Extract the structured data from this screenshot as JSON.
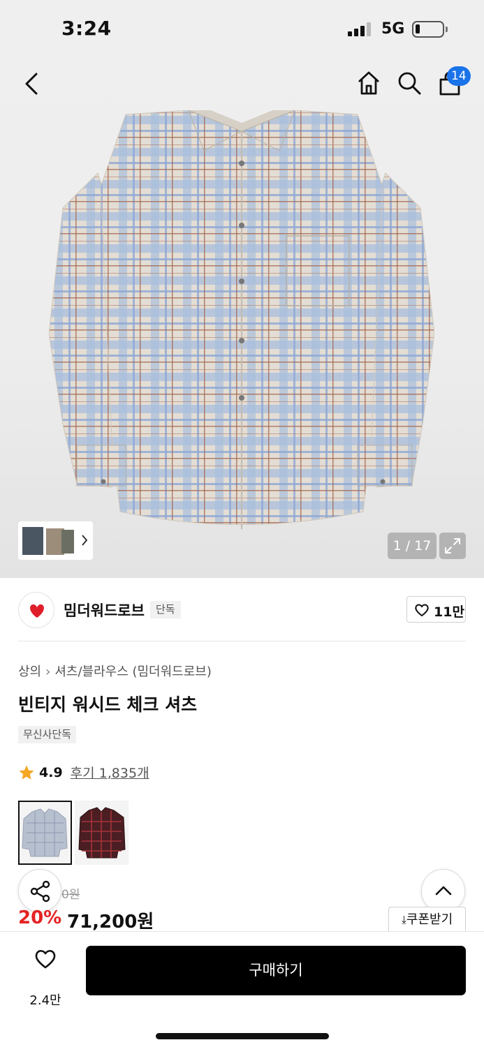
{
  "status_bar": {
    "time": "3:24",
    "network": "5G",
    "battery_level": 0.18
  },
  "header": {
    "cart_count": "14",
    "icons": [
      "back-icon",
      "home-icon",
      "search-icon",
      "bag-icon"
    ]
  },
  "gallery": {
    "counter": "1 / 17"
  },
  "brand": {
    "name": "밈더워드로브",
    "tag": "단독",
    "likes": "11만"
  },
  "breadcrumb": {
    "category": "상의",
    "subcategory": "셔츠/블라우스 (밈더워드로브)"
  },
  "product": {
    "title": "빈티지 워시드 체크 셔츠",
    "exclusive_badge": "무신사단독",
    "rating": "4.9",
    "reviews": "후기 1,835개",
    "original_price_fragment": "0원",
    "discount": "20%",
    "price": "71,200원",
    "coupon_label": "쿠폰받기"
  },
  "bottom_bar": {
    "wish_count": "2.4만",
    "buy_label": "구매하기"
  },
  "colors": {
    "accent_red": "#e52222",
    "badge_blue": "#1a73e8",
    "buy_black": "#000000"
  }
}
